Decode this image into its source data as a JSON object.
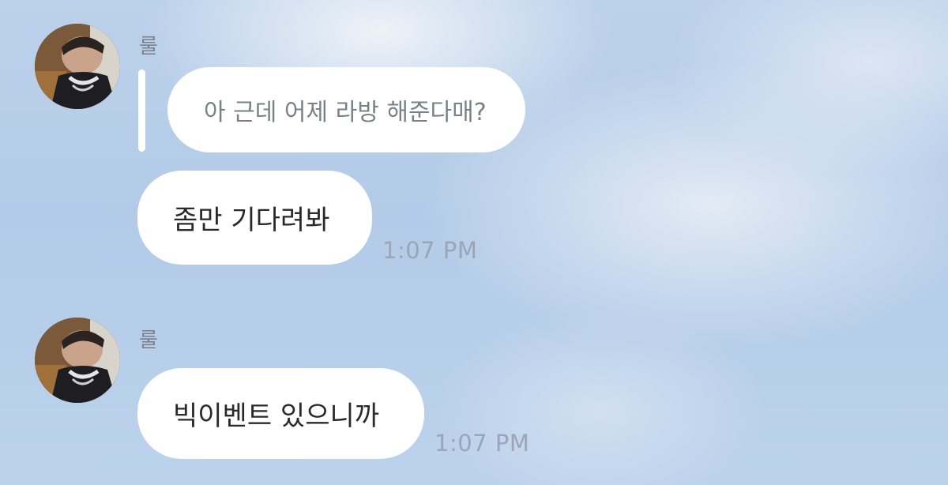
{
  "messages": [
    {
      "sender": "룰",
      "quoted_text": "아 근데 어제 라방 해준다매?",
      "text": "좀만 기다려봐",
      "time": "1:07 PM"
    },
    {
      "sender": "룰",
      "text": "빅이벤트 있으니까",
      "time": "1:07 PM"
    }
  ],
  "colors": {
    "bubble": "#ffffff",
    "sender_name": "#7a7f8a",
    "timestamp": "#9ba5b5",
    "message_text": "#2a2a2e",
    "background": "#b3cbe8"
  },
  "icons": {
    "avatar": "profile-photo-avatar"
  }
}
